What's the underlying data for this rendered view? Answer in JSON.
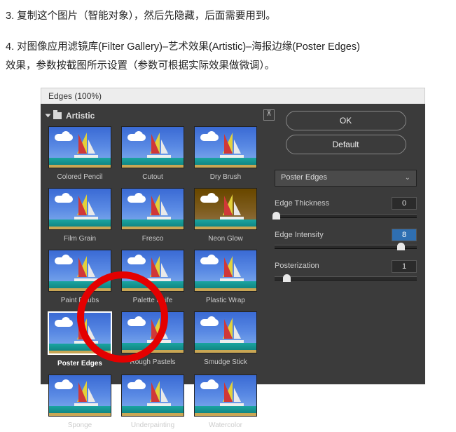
{
  "steps": {
    "s3": "3. 复制这个图片（智能对象），然后先隐藏，后面需要用到。",
    "s4a": "4. 对图像应用滤镜库(Filter Gallery)–艺术效果(Artistic)–海报边缘(Poster Edges)",
    "s4b": "效果，参数按截图所示设置（参数可根据实际效果做微调）。"
  },
  "titlebar": "Edges (100%)",
  "category": "Artistic",
  "thumbs": {
    "r0c0": "Colored Pencil",
    "r0c1": "Cutout",
    "r0c2": "Dry Brush",
    "r1c0": "Film Grain",
    "r1c1": "Fresco",
    "r1c2": "Neon Glow",
    "r2c0": "Paint Daubs",
    "r2c1": "Palette Knife",
    "r2c2": "Plastic Wrap",
    "r3c0": "Poster Edges",
    "r3c1": "Rough Pastels",
    "r3c2": "Smudge Stick",
    "r4c0": "Sponge",
    "r4c1": "Underpainting",
    "r4c2": "Watercolor"
  },
  "buttons": {
    "ok": "OK",
    "default": "Default"
  },
  "filterSelect": "Poster Edges",
  "params": {
    "edgeThickness": {
      "label": "Edge Thickness",
      "value": "0"
    },
    "edgeIntensity": {
      "label": "Edge Intensity",
      "value": "8"
    },
    "posterization": {
      "label": "Posterization",
      "value": "1"
    }
  },
  "collapse": "⊼"
}
